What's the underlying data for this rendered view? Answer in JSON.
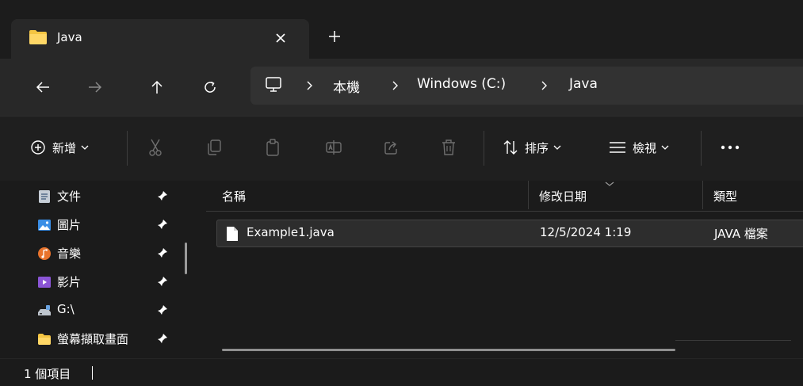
{
  "tab": {
    "title": "Java",
    "close_glyph": "✕",
    "new_tab_glyph": "+"
  },
  "nav": {
    "breadcrumbs": [
      "本機",
      "Windows (C:)",
      "Java"
    ]
  },
  "toolbar": {
    "new_label": "新增",
    "sort_label": "排序",
    "view_label": "檢視",
    "more_glyph": "•••"
  },
  "sidebar": {
    "items": [
      {
        "label": "文件",
        "icon": "documents-icon",
        "pinned": true
      },
      {
        "label": "圖片",
        "icon": "pictures-icon",
        "pinned": true
      },
      {
        "label": "音樂",
        "icon": "music-icon",
        "pinned": true
      },
      {
        "label": "影片",
        "icon": "videos-icon",
        "pinned": true
      },
      {
        "label": "G:\\",
        "icon": "drive-icon",
        "pinned": true
      },
      {
        "label": "螢幕擷取畫面",
        "icon": "folder-icon",
        "pinned": true
      }
    ]
  },
  "files": {
    "columns": [
      "名稱",
      "修改日期",
      "類型"
    ],
    "rows": [
      {
        "name": "Example1.java",
        "modified": "12/5/2024 1:19",
        "type": "JAVA 檔案"
      }
    ]
  },
  "status": {
    "item_count": "1 個項目"
  },
  "colors": {
    "folder": "#f5c542",
    "background": "#1b1b1b",
    "nav_bar": "#282828",
    "selected_row": "#2d2d2d"
  }
}
